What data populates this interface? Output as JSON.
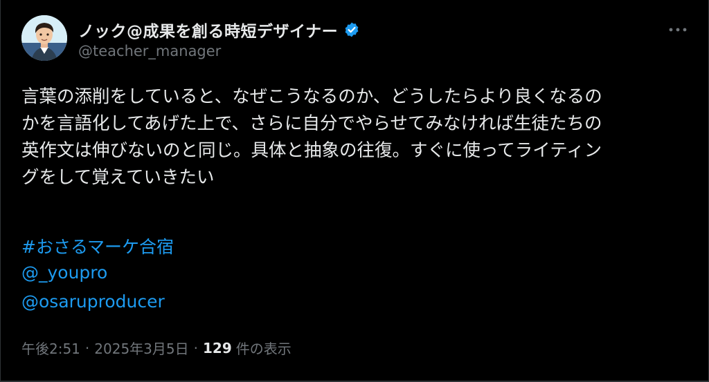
{
  "author": {
    "display_name": "ノック@成果を創る時短デザイナー",
    "handle": "@teacher_manager",
    "verified": true
  },
  "tweet": {
    "lines": [
      "言葉の添削をしていると、なぜこうなるのか、どうしたらより良くなるの",
      "かを言語化してあげた上で、さらに自分でやらせてみなければ生徒たちの",
      "英作文は伸びないのと同じ。具体と抽象の往復。すぐに使ってライティン",
      "グをして覚えていきたい"
    ],
    "hashtag": "#おさるマーケ合宿",
    "mentions": [
      "@_youpro",
      "@osaruproducer"
    ]
  },
  "meta": {
    "time": "午後2:51",
    "separator": "·",
    "date": "2025年3月5日",
    "view_count": "129",
    "view_label": "件の表示"
  },
  "icons": {
    "verified": "verified-badge-icon",
    "more": "more-options-icon"
  },
  "colors": {
    "background": "#000000",
    "text": "#e7e9ea",
    "muted": "#71767b",
    "link": "#1d9bf0",
    "verified": "#1d9bf0"
  }
}
